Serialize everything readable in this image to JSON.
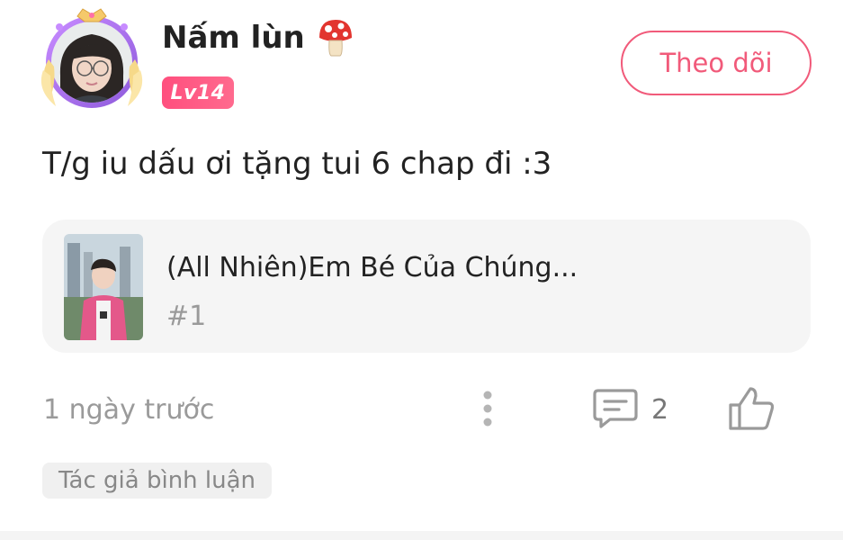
{
  "user": {
    "name": "Nấm lùn",
    "level": "Lv14"
  },
  "follow_button": {
    "label": "Theo dõi"
  },
  "comment": {
    "text": "T/g iu dấu ơi tặng tui 6 chap đi :3"
  },
  "story": {
    "title": "(All Nhiên)Em Bé Của Chúng...",
    "chapter": "#1"
  },
  "meta": {
    "time": "1 ngày trước",
    "comment_count": "2",
    "author_tag": "Tác giả bình luận"
  },
  "colors": {
    "accent": "#f15a7a",
    "badge": "#ff4f7e",
    "muted_text": "#9a9a9a",
    "card_bg": "#f5f5f5"
  },
  "icons": [
    "mushroom-icon",
    "more-vertical-icon",
    "comment-icon",
    "thumbs-up-icon"
  ]
}
